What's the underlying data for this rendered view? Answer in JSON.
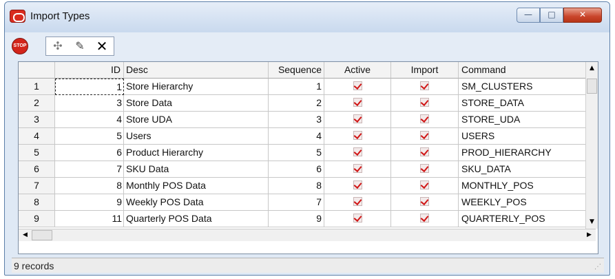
{
  "window": {
    "title": "Import Types",
    "minimize_label": "—",
    "maximize_label": "□",
    "close_label": "✕"
  },
  "toolbar": {
    "stop_label": "STOP",
    "add_glyph": "✣",
    "edit_glyph": "✎",
    "delete_glyph": "✕"
  },
  "grid": {
    "columns": [
      "",
      "ID",
      "Desc",
      "Sequence",
      "Active",
      "Import",
      "Command"
    ],
    "rows": [
      {
        "n": "1",
        "id": "1",
        "desc": "Store Hierarchy",
        "seq": "1",
        "active": true,
        "import": true,
        "cmd": "SM_CLUSTERS"
      },
      {
        "n": "2",
        "id": "3",
        "desc": "Store Data",
        "seq": "2",
        "active": true,
        "import": true,
        "cmd": "STORE_DATA"
      },
      {
        "n": "3",
        "id": "4",
        "desc": "Store UDA",
        "seq": "3",
        "active": true,
        "import": true,
        "cmd": "STORE_UDA"
      },
      {
        "n": "4",
        "id": "5",
        "desc": "Users",
        "seq": "4",
        "active": true,
        "import": true,
        "cmd": "USERS"
      },
      {
        "n": "5",
        "id": "6",
        "desc": "Product Hierarchy",
        "seq": "5",
        "active": true,
        "import": true,
        "cmd": "PROD_HIERARCHY"
      },
      {
        "n": "6",
        "id": "7",
        "desc": "SKU Data",
        "seq": "6",
        "active": true,
        "import": true,
        "cmd": "SKU_DATA"
      },
      {
        "n": "7",
        "id": "8",
        "desc": "Monthly POS Data",
        "seq": "8",
        "active": true,
        "import": true,
        "cmd": "MONTHLY_POS"
      },
      {
        "n": "8",
        "id": "9",
        "desc": "Weekly POS Data",
        "seq": "7",
        "active": true,
        "import": true,
        "cmd": "WEEKLY_POS"
      },
      {
        "n": "9",
        "id": "11",
        "desc": "Quarterly POS Data",
        "seq": "9",
        "active": true,
        "import": true,
        "cmd": "QUARTERLY_POS"
      }
    ],
    "selected_row": 0
  },
  "status": {
    "text": "9 records"
  },
  "scroll": {
    "up_glyph": "▲",
    "down_glyph": "▼",
    "left_glyph": "◀",
    "right_glyph": "▶"
  },
  "colors": {
    "check": "#d01616",
    "accent": "#5a7ea8"
  }
}
